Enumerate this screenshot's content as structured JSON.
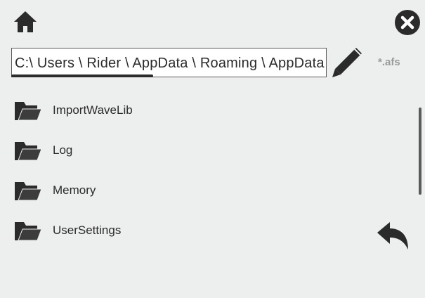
{
  "toolbar": {
    "home_icon": "home-icon",
    "close_icon": "close-icon",
    "edit_icon": "pencil-icon",
    "back_icon": "back-arrow-icon",
    "filter": "*.afs"
  },
  "path": {
    "value": "C:\\ Users \\ Rider  \\ AppData \\ Roaming \\ AppData"
  },
  "folders": [
    {
      "label": "ImportWaveLib",
      "icon": "folder-icon"
    },
    {
      "label": "Log",
      "icon": "folder-icon"
    },
    {
      "label": "Memory",
      "icon": "folder-icon"
    },
    {
      "label": "UserSettings",
      "icon": "folder-icon"
    }
  ],
  "colors": {
    "background": "#edeeee",
    "icon": "#2b2b2b",
    "filter_text": "#9a9a9a"
  }
}
